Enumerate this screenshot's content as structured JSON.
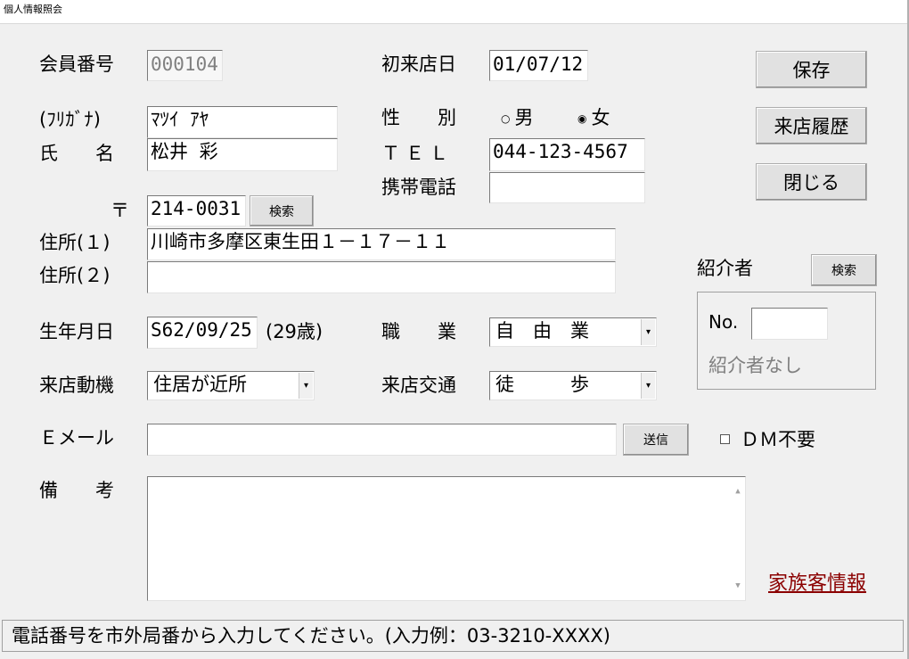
{
  "window": {
    "title": "個人情報照会"
  },
  "labels": {
    "member_no": "会員番号",
    "first_visit": "初来店日",
    "furigana": "(ﾌﾘｶﾞﾅ)",
    "gender": "性　　別",
    "name": "氏　　名",
    "tel": "ＴＥＬ",
    "mobile": "携帯電話",
    "postal": "〒",
    "address1": "住所(１)",
    "address2": "住所(２)",
    "birthday": "生年月日",
    "age": "(29歳)",
    "occupation": "職　　業",
    "visit_motive": "来店動機",
    "transport": "来店交通",
    "email": "Ｅメール",
    "notes": "備　　考",
    "referrer": "紹介者",
    "referrer_no": "No.",
    "referrer_none": "紹介者なし"
  },
  "values": {
    "member_no": "000104",
    "first_visit": "01/07/12",
    "furigana": "ﾏﾂｲ ｱﾔ",
    "name": "松井 彩",
    "tel": "044-123-4567",
    "mobile": "",
    "postal": "214-0031",
    "address1": "川崎市多摩区東生田１－１７－１１",
    "address2": "",
    "birthday": "S62/09/25",
    "occupation": "自　由　業",
    "visit_motive": "住居が近所",
    "transport": "徒　　　歩",
    "email": "",
    "notes": "",
    "referrer_no": ""
  },
  "gender": {
    "options": [
      "男",
      "女"
    ],
    "selected": "女"
  },
  "buttons": {
    "save": "保存",
    "history": "来店履歴",
    "close": "閉じる",
    "postal_search": "検索",
    "referrer_search": "検索",
    "send": "送信"
  },
  "dm_opt_out": {
    "label": "ＤＭ不要",
    "checked": false
  },
  "family_link": "家族客情報",
  "status_message": "電話番号を市外局番から入力してください。(入力例：03-3210-XXXX)",
  "colors": {
    "link": "#8b0000",
    "background": "#f0f0f0"
  }
}
